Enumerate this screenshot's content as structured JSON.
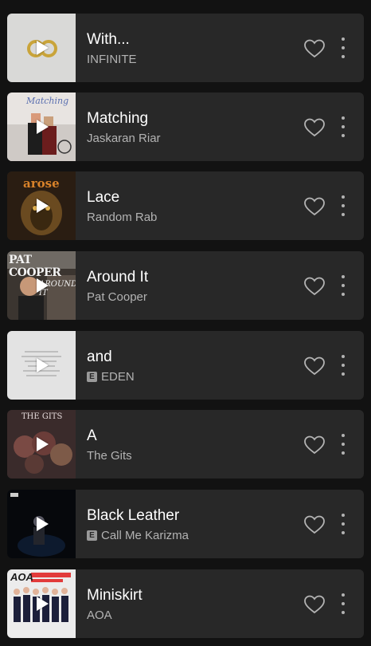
{
  "tracks": [
    {
      "title": "With...",
      "artist": "INFINITE",
      "explicit": false
    },
    {
      "title": "Matching",
      "artist": "Jaskaran Riar",
      "explicit": false
    },
    {
      "title": "Lace",
      "artist": "Random Rab",
      "explicit": false
    },
    {
      "title": "Around It",
      "artist": "Pat Cooper",
      "explicit": false
    },
    {
      "title": "and",
      "artist": "EDEN",
      "explicit": true
    },
    {
      "title": "A",
      "artist": "The Gits",
      "explicit": false
    },
    {
      "title": "Black Leather",
      "artist": "Call Me Karizma",
      "explicit": true
    },
    {
      "title": "Miniskirt",
      "artist": "AOA",
      "explicit": false
    }
  ],
  "art_text": {
    "matching": "Matching",
    "arose": "arose",
    "pat_cooper": "PAT COOPER",
    "around_it": "AROUND IT",
    "the_gits": "THE GITS",
    "aoa": "AOA"
  },
  "explicit_label": "E",
  "colors": {
    "background": "#121212",
    "card": "#282828",
    "text_primary": "#ffffff",
    "text_secondary": "#b3b3b3"
  }
}
